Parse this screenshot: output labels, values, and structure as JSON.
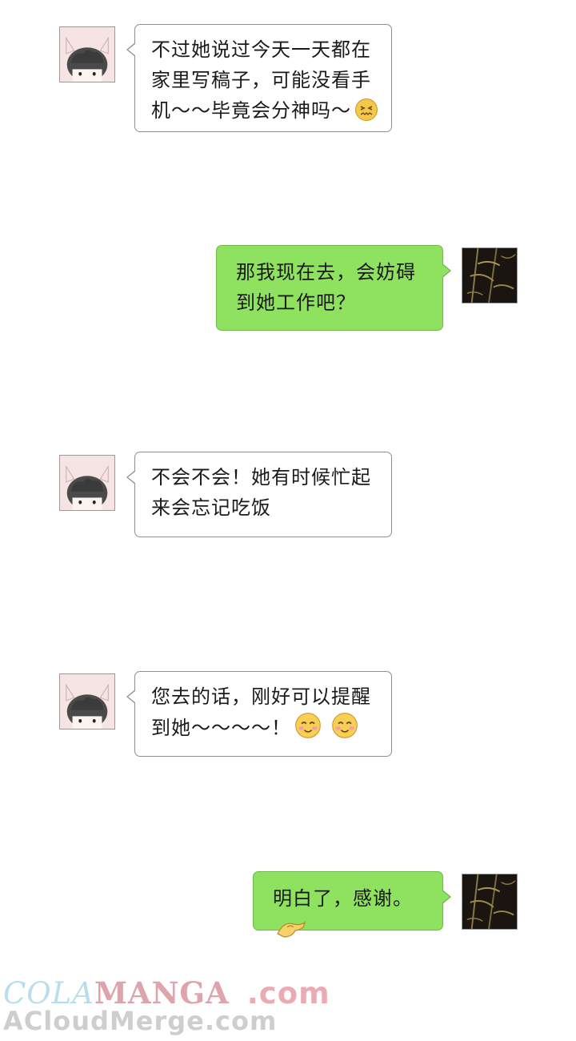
{
  "messages": [
    {
      "side": "left",
      "text_lines": [
        "不过她说过今天一天都在",
        "家里写稿子，可能没看手",
        "机～～毕竟会分神吗～"
      ],
      "emoji": "dizzy-face"
    },
    {
      "side": "right",
      "text_lines": [
        "那我现在去，会妨碍",
        "到她工作吧？"
      ]
    },
    {
      "side": "left",
      "text_lines": [
        "不会不会！她有时候忙起",
        "来会忘记吃饭"
      ]
    },
    {
      "side": "left",
      "text_lines": [
        "您去的话，刚好可以提醒",
        "到她～～～～！"
      ],
      "emoji": "smiling-face"
    },
    {
      "side": "right",
      "text_lines": [
        "明白了，感谢。"
      ],
      "emoji": "ok-hand"
    }
  ],
  "avatars": {
    "contact": "cat-ear-girl-avatar",
    "self": "bamboo-avatar"
  },
  "watermark": {
    "line1a": "COLA",
    "line1b": "MANGA",
    "line1c": ".com",
    "line2": "ACloudMerge.com"
  },
  "colors": {
    "left_bubble": "#ffffff",
    "right_bubble": "#8fe25f",
    "border": "#8f8f8f"
  }
}
